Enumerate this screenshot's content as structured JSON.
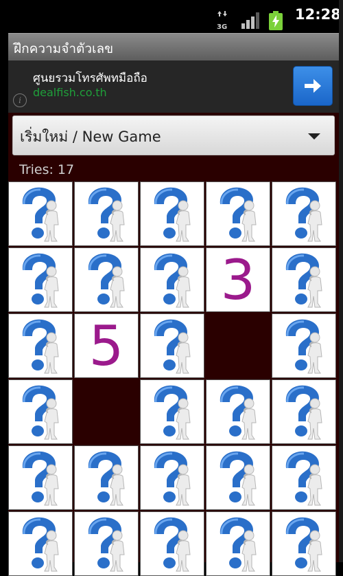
{
  "status_bar": {
    "network": "3G",
    "time": "12:28",
    "icons": [
      "data-arrows-icon",
      "signal-icon",
      "battery-charging-icon"
    ]
  },
  "app": {
    "title": "ฝึกความจำตัวเลข"
  },
  "ad": {
    "title": "ศูนยรวมโทรศัพทมือถือ",
    "url": "dealfish.co.th",
    "info_icon": "info-icon",
    "go_icon": "arrow-right-icon"
  },
  "game": {
    "new_game_label": "เริ่มใหม่ / New Game",
    "tries_text": "Tries: 17",
    "columns": 5,
    "rows": 6,
    "cells": [
      {
        "state": "hidden"
      },
      {
        "state": "hidden"
      },
      {
        "state": "hidden"
      },
      {
        "state": "hidden"
      },
      {
        "state": "hidden"
      },
      {
        "state": "hidden"
      },
      {
        "state": "hidden"
      },
      {
        "state": "hidden"
      },
      {
        "state": "revealed",
        "value": "3"
      },
      {
        "state": "hidden"
      },
      {
        "state": "hidden"
      },
      {
        "state": "revealed",
        "value": "5"
      },
      {
        "state": "hidden"
      },
      {
        "state": "matched"
      },
      {
        "state": "hidden"
      },
      {
        "state": "hidden"
      },
      {
        "state": "matched"
      },
      {
        "state": "hidden"
      },
      {
        "state": "hidden"
      },
      {
        "state": "hidden"
      },
      {
        "state": "hidden"
      },
      {
        "state": "hidden"
      },
      {
        "state": "hidden"
      },
      {
        "state": "hidden"
      },
      {
        "state": "hidden"
      },
      {
        "state": "hidden"
      },
      {
        "state": "hidden"
      },
      {
        "state": "hidden"
      },
      {
        "state": "hidden"
      },
      {
        "state": "hidden"
      }
    ]
  },
  "colors": {
    "background": "#2a0000",
    "number": "#9b1a8c",
    "question_mark": "#2a6fc9",
    "ad_url": "#1f9f3a"
  }
}
